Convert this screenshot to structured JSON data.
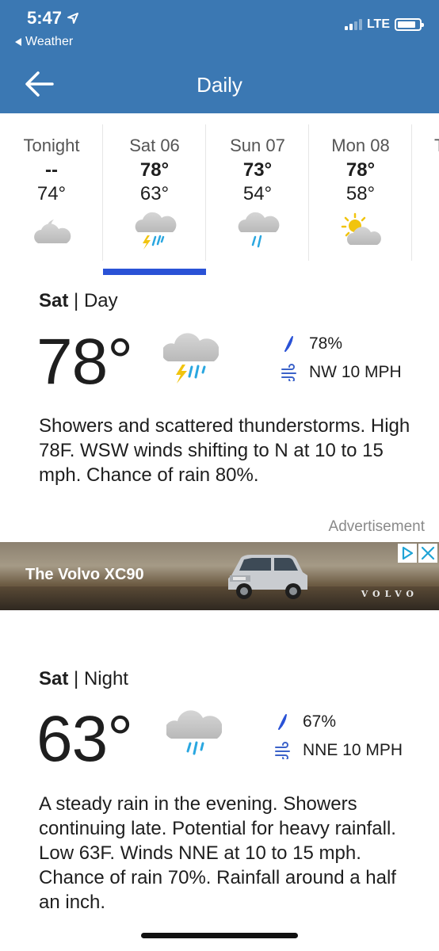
{
  "status_bar": {
    "time": "5:47",
    "back_app": "Weather",
    "network": "LTE",
    "battery_level": 0.85,
    "signal_bars": 2
  },
  "header": {
    "title": "Daily"
  },
  "days": [
    {
      "name": "Tonight",
      "high": "--",
      "low": "74°",
      "icon": "partly-cloudy-night-icon",
      "selected": false
    },
    {
      "name": "Sat 06",
      "high": "78°",
      "low": "63°",
      "icon": "thunderstorm-rain-icon",
      "selected": true
    },
    {
      "name": "Sun 07",
      "high": "73°",
      "low": "54°",
      "icon": "rain-cloud-icon",
      "selected": false
    },
    {
      "name": "Mon 08",
      "high": "78°",
      "low": "58°",
      "icon": "partly-sunny-icon",
      "selected": false
    },
    {
      "name": "T",
      "high": "",
      "low": "",
      "icon": "",
      "selected": false
    }
  ],
  "day_detail": {
    "label_day": "Sat",
    "label_separator": "|",
    "label_period": "Day",
    "temp": "78°",
    "icon": "thunderstorm-rain-icon",
    "precip": "78%",
    "wind": "NW 10 MPH",
    "narrative": "Showers and scattered thunderstorms. High 78F. WSW winds shifting to N at 10 to 15 mph. Chance of rain 80%."
  },
  "ad": {
    "label": "Advertisement",
    "headline": "The Volvo XC90",
    "brand": "VOLVO"
  },
  "night_detail": {
    "label_day": "Sat",
    "label_separator": "|",
    "label_period": "Night",
    "temp": "63°",
    "icon": "rain-cloud-icon",
    "precip": "67%",
    "wind": "NNE 10 MPH",
    "narrative": "A steady rain in the evening. Showers continuing late. Potential for heavy rainfall. Low 63F. Winds NNE at 10 to 15 mph. Chance of rain 70%. Rainfall around a half an inch."
  },
  "colors": {
    "header_bg": "#3b78b3",
    "selected_tab": "#2a52d6",
    "precip_icon": "#2a52d6",
    "wind_icon": "#3b62c9",
    "rain_drop": "#2aa7e0",
    "lightning": "#f1c40f"
  }
}
